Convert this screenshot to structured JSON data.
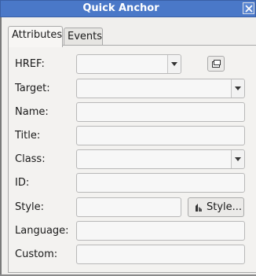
{
  "window": {
    "title": "Quick Anchor"
  },
  "tabs": [
    {
      "label": "Attributes",
      "active": true
    },
    {
      "label": "Events",
      "active": false
    }
  ],
  "fields": {
    "href": {
      "label": "HREF:",
      "value": ""
    },
    "target": {
      "label": "Target:",
      "value": ""
    },
    "name": {
      "label": "Name:",
      "value": ""
    },
    "title": {
      "label": "Title:",
      "value": ""
    },
    "class": {
      "label": "Class:",
      "value": ""
    },
    "id": {
      "label": "ID:",
      "value": ""
    },
    "style": {
      "label": "Style:",
      "value": "",
      "button_label": "Style..."
    },
    "language": {
      "label": "Language:",
      "value": ""
    },
    "custom": {
      "label": "Custom:",
      "value": ""
    }
  },
  "icons": {
    "close": "close-icon",
    "browse": "folder-icon",
    "style": "style-brush-icon",
    "dropdown": "dropdown-arrow-icon"
  },
  "colors": {
    "titlebar": "#4a78c8",
    "title_text": "#ffffff"
  }
}
